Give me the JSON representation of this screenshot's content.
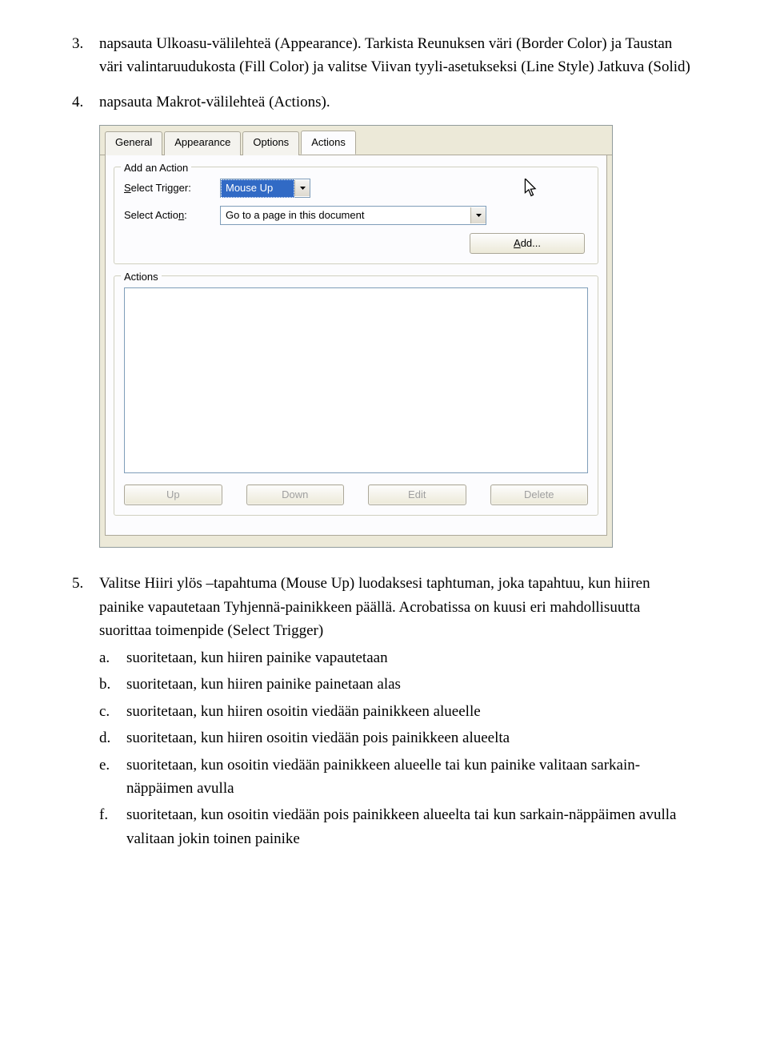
{
  "steps": {
    "s3": {
      "num": "3.",
      "text": "napsauta Ulkoasu-välilehteä (Appearance). Tarkista Reunuksen väri (Border Color) ja Taustan väri valintaruudukosta (Fill Color) ja valitse Viivan tyyli-asetukseksi (Line Style) Jatkuva (Solid)"
    },
    "s4": {
      "num": "4.",
      "text": "napsauta Makrot-välilehteä (Actions)."
    },
    "s5": {
      "num": "5.",
      "intro_a": "Valitse Hiiri ylös –tapahtuma (Mouse Up) luodaksesi taphtuman, joka tapahtuu, kun hiiren painike vapautetaan Tyhjennä-painikkeen päällä. Acrobatissa on kuusi eri mahdollisuutta suorittaa toimenpide (Select Trigger)",
      "a": {
        "num": "a.",
        "text": "suoritetaan, kun hiiren painike vapautetaan"
      },
      "b": {
        "num": "b.",
        "text": "suoritetaan, kun hiiren painike painetaan alas"
      },
      "c": {
        "num": "c.",
        "text": "suoritetaan, kun hiiren osoitin viedään painikkeen alueelle"
      },
      "d": {
        "num": "d.",
        "text": "suoritetaan, kun hiiren osoitin viedään pois painikkeen alueelta"
      },
      "e": {
        "num": "e.",
        "text": "suoritetaan, kun osoitin viedään painikkeen alueelle tai kun painike valitaan sarkain-näppäimen avulla"
      },
      "f": {
        "num": "f.",
        "text": "suoritetaan, kun osoitin viedään pois painikkeen alueelta tai kun sarkain-näppäimen avulla valitaan jokin toinen painike"
      }
    }
  },
  "dialog": {
    "tabs": {
      "general": "General",
      "appearance": "Appearance",
      "options": "Options",
      "actions": "Actions"
    },
    "group_add": "Add an Action",
    "label_trigger_pre": "S",
    "label_trigger_post": "elect Trigger:",
    "trigger_value": "Mouse Up",
    "label_action_pre": "Select Actio",
    "label_action_u": "n",
    "label_action_post": ":",
    "action_value": "Go to a page in this document",
    "btn_add_u": "A",
    "btn_add_rest": "dd...",
    "group_actions": "Actions",
    "btn_up": "Up",
    "btn_down": "Down",
    "btn_edit": "Edit",
    "btn_delete": "Delete"
  }
}
